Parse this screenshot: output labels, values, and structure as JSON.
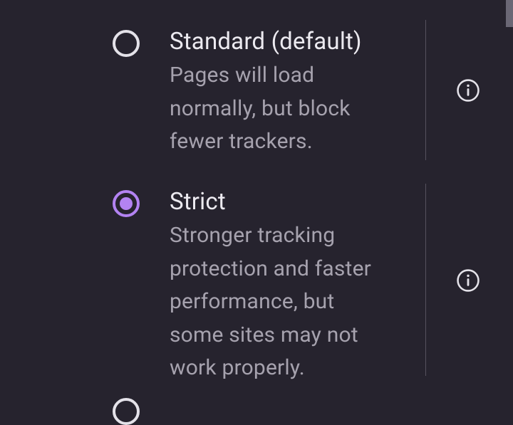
{
  "options": [
    {
      "title": "Standard (default)",
      "description": "Pages will load normally, but block fewer trackers.",
      "selected": false
    },
    {
      "title": "Strict",
      "description": "Stronger tracking protection and faster performance, but some sites may not work properly.",
      "selected": true
    }
  ]
}
